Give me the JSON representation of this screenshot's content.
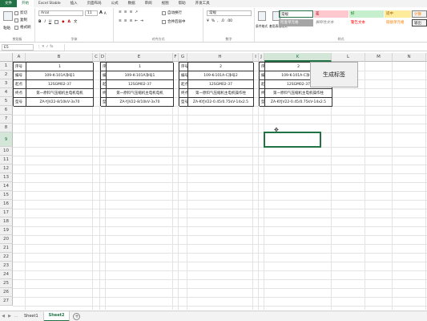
{
  "menu": {
    "tabs": [
      "文件",
      "开始",
      "Excel Stable",
      "插入",
      "页面布局",
      "公式",
      "数据",
      "审阅",
      "视图",
      "帮助",
      "开发工具"
    ],
    "active_index": 1
  },
  "ribbon": {
    "clipboard": {
      "paste": "粘贴",
      "cut": "剪切",
      "copy": "复制",
      "format_painter": "格式刷",
      "label": "剪贴板"
    },
    "font": {
      "name": "Arial",
      "size": "11",
      "label": "字体"
    },
    "alignment": {
      "wrap": "自动换行",
      "merge": "合并后居中",
      "label": "对齐方式"
    },
    "number": {
      "format": "常规",
      "label": "数字"
    },
    "styles": {
      "conditional": "条件格式",
      "table_format": "套用表格格式",
      "cells": [
        {
          "text": "常规",
          "bg": "#ffffff",
          "color": "#222222"
        },
        {
          "text": "差",
          "bg": "#ffc7ce",
          "color": "#9c0006"
        },
        {
          "text": "好",
          "bg": "#c6efce",
          "color": "#006100"
        },
        {
          "text": "适中",
          "bg": "#ffeb9c",
          "color": "#9c5700"
        },
        {
          "text": "计算",
          "bg": "#f2f2f2",
          "color": "#fa7d00"
        },
        {
          "text": "检查单元格",
          "bg": "#a5a5a5",
          "color": "#ffffff"
        },
        {
          "text": "解释性文本",
          "bg": "#ffffff",
          "color": "#7f7f7f"
        },
        {
          "text": "警告文本",
          "bg": "#ffffff",
          "color": "#ff0000"
        },
        {
          "text": "链接单元格",
          "bg": "#ffffff",
          "color": "#fa7d00"
        },
        {
          "text": "输出",
          "bg": "#f2f2f2",
          "color": "#3f3f3f"
        }
      ],
      "label": "样式"
    }
  },
  "formula_bar": {
    "name_box": "E5",
    "fx": "fx"
  },
  "columns": [
    "A",
    "B",
    "C",
    "D",
    "E",
    "F",
    "G",
    "H",
    "I",
    "J",
    "K",
    "L",
    "M",
    "N",
    "O"
  ],
  "selected_column": "K",
  "rows": [
    "1",
    "2",
    "3",
    "4",
    "5",
    "6",
    "7",
    "8",
    "9",
    "10",
    "11",
    "12",
    "13",
    "14",
    "15",
    "16",
    "17",
    "18",
    "19",
    "20",
    "21",
    "22",
    "23",
    "24",
    "25",
    "26",
    "27"
  ],
  "selected_row": "9",
  "tables": [
    {
      "labels": [
        "序号",
        "编号",
        "起点",
        "终点",
        "型号"
      ],
      "values": [
        "1",
        "109-K-101A净号1",
        "12SGM02-37",
        "第一原料气压缩机主电机电机",
        "ZA-YJV22-8/10kV-3x70"
      ]
    },
    {
      "labels": [
        "序号",
        "编号",
        "起点",
        "终点",
        "型号"
      ],
      "values": [
        "1",
        "109-K-101A净号1",
        "12SGM02-37",
        "第一原料气压缩机主电机电机",
        "ZA-YJV22-8/10kV-3x70"
      ]
    },
    {
      "labels": [
        "序号",
        "编号",
        "起点",
        "终点",
        "型号"
      ],
      "values": [
        "2",
        "109-K-101A-C净号2",
        "12SGM02-37",
        "第一原料气压缩机主电机操作柱",
        "ZA-KYJV22-0.45/0.75kV-14x2.5"
      ]
    },
    {
      "labels": [
        "序号",
        "编号",
        "起点",
        "终点",
        "型号"
      ],
      "values": [
        "2",
        "109-K-101A-C净号2",
        "12SGM02-37",
        "第一原料气压缩机主电机操作柱",
        "ZA-KYJV22-0.45/0.75kV-14x2.5"
      ]
    }
  ],
  "button_label": "生成标签",
  "sheets": [
    "Sheet1",
    "Sheet2"
  ],
  "active_sheet": 1
}
